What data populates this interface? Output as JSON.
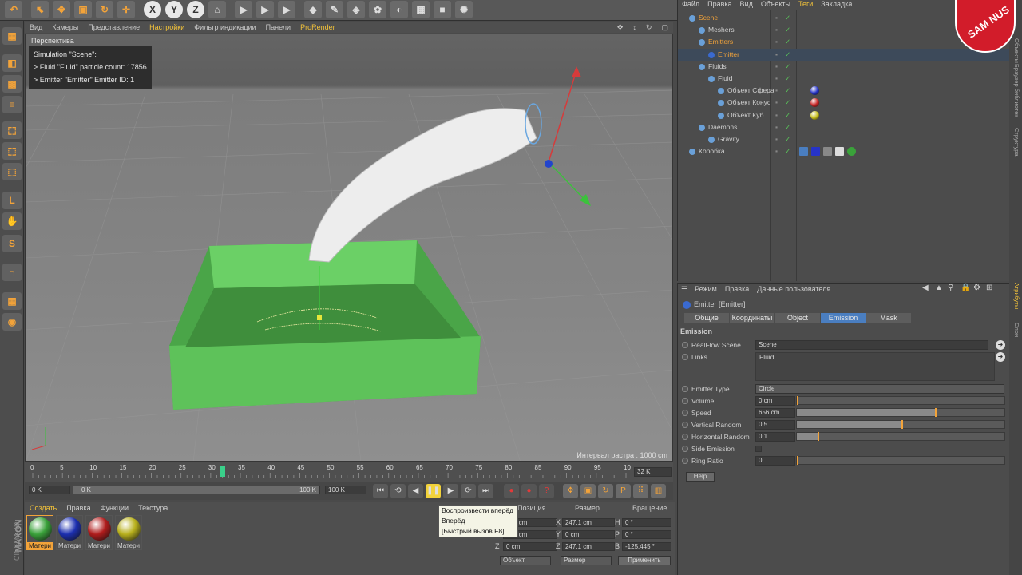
{
  "colors": {
    "accent": "#f2a33a",
    "selected_tab": "#4a7ec0",
    "green_box": "#5ec25a",
    "mat_green": "#3aa23a",
    "mat_blue": "#1c2fb0",
    "mat_red": "#b01c1c",
    "mat_yellow": "#b8b01c"
  },
  "topbar_icons": [
    "undo-icon",
    "select-icon",
    "move-icon",
    "scale-icon",
    "rotate-icon",
    "add-icon",
    "x-axis-icon",
    "y-axis-icon",
    "z-axis-icon",
    "coord-icon",
    "render-icon",
    "render-view-icon",
    "render-settings-icon",
    "cube-icon",
    "pen-icon",
    "subdivide-icon",
    "deform-icon",
    "scene-icon",
    "floor-icon",
    "camera-icon",
    "light-icon"
  ],
  "viewport_menu": [
    "Вид",
    "Камеры",
    "Представление",
    "Настройки",
    "Фильтр индикации",
    "Панели",
    "ProRender"
  ],
  "viewport": {
    "label": "Перспектива",
    "hud": [
      "Simulation \"Scene\":",
      "> Fluid \"Fluid\" particle count: 17856",
      "> Emitter \"Emitter\" Emitter ID: 1"
    ],
    "grid_info": "Интервал растра : 1000 cm"
  },
  "timeline": {
    "ticks": [
      "0",
      "5",
      "10",
      "15",
      "20",
      "25",
      "30",
      "35",
      "40",
      "45",
      "50",
      "55",
      "60",
      "65",
      "70",
      "75",
      "80",
      "85",
      "90",
      "95",
      "10"
    ],
    "end_frame": "32 K",
    "current": 0.32
  },
  "transport": {
    "start": "0 K",
    "range_start": "0 K",
    "range_end": "100 K",
    "end": "100 K"
  },
  "tooltip": [
    "Воспроизвести вперёд",
    "Вперёд",
    "[Быстрый вызов F8]"
  ],
  "materials": {
    "menu": [
      "Создать",
      "Правка",
      "Функции",
      "Текстура"
    ],
    "items": [
      "Матери",
      "Матери",
      "Матери",
      "Матери"
    ],
    "brand": "MAXON",
    "product": "CINEMA 4D"
  },
  "coords": {
    "headers": [
      "Позиция",
      "Размер",
      "Вращение"
    ],
    "rows": [
      {
        "axis": "X",
        "pos": "158 cm",
        "size_axis": "X",
        "size": "247.1 cm",
        "rot_axis": "H",
        "rot": "0 °"
      },
      {
        "axis": "Y",
        "pos": "133 cm",
        "size_axis": "Y",
        "size": "0 cm",
        "rot_axis": "P",
        "rot": "0 °"
      },
      {
        "axis": "Z",
        "pos": "0 cm",
        "size_axis": "Z",
        "size": "247.1 cm",
        "rot_axis": "B",
        "rot": "-125.445 °"
      }
    ],
    "mode": "Объект",
    "size_mode": "Размер",
    "apply": "Применить"
  },
  "objmgr": {
    "menu": [
      "Файл",
      "Правка",
      "Вид",
      "Объекты",
      "Теги",
      "Закладка"
    ],
    "tree": [
      {
        "label": "Scene",
        "indent": 0,
        "color": "#f2a33a"
      },
      {
        "label": "Meshers",
        "indent": 1,
        "color": "#cfcfcf"
      },
      {
        "label": "Emitters",
        "indent": 1,
        "color": "#f2a33a"
      },
      {
        "label": "Emitter",
        "indent": 2,
        "color": "#f2a33a"
      },
      {
        "label": "Fluids",
        "indent": 1,
        "color": "#cfcfcf"
      },
      {
        "label": "Fluid",
        "indent": 2,
        "color": "#cfcfcf"
      },
      {
        "label": "Объект Сфера",
        "indent": 3,
        "color": "#cfcfcf"
      },
      {
        "label": "Объект Конус",
        "indent": 3,
        "color": "#cfcfcf"
      },
      {
        "label": "Объект Куб",
        "indent": 3,
        "color": "#cfcfcf"
      },
      {
        "label": "Daemons",
        "indent": 1,
        "color": "#cfcfcf"
      },
      {
        "label": "Gravity",
        "indent": 2,
        "color": "#cfcfcf"
      },
      {
        "label": "Коробка",
        "indent": 0,
        "color": "#cfcfcf"
      }
    ]
  },
  "attr": {
    "menu": [
      "Режим",
      "Правка",
      "Данные пользователя"
    ],
    "title": "Emitter [Emitter]",
    "tabs": [
      "Общие",
      "Координаты",
      "Object",
      "Emission",
      "Mask"
    ],
    "active_tab": 3,
    "section": "Emission",
    "realflow_label": "RealFlow Scene",
    "realflow_value": "Scene",
    "links_label": "Links",
    "links_value": "Fluid",
    "params": [
      {
        "label": "Emitter Type",
        "value": "Circle",
        "kind": "dropdown"
      },
      {
        "label": "Volume",
        "value": "0 cm",
        "kind": "slider",
        "fill": 0.0
      },
      {
        "label": "Speed",
        "value": "656 cm",
        "kind": "slider",
        "fill": 0.66
      },
      {
        "label": "Vertical Random",
        "value": "0.5",
        "kind": "slider",
        "fill": 0.5
      },
      {
        "label": "Horizontal Random",
        "value": "0.1",
        "kind": "slider",
        "fill": 0.1
      },
      {
        "label": "Side Emission",
        "value": "",
        "kind": "checkbox"
      },
      {
        "label": "Ring Ratio",
        "value": "0",
        "kind": "slider",
        "fill": 0.0
      }
    ],
    "help": "Help"
  },
  "right_strip": [
    "Объекты",
    "Браузер библиотек",
    "Структура",
    "Атрибуты",
    "Слои"
  ],
  "logo": "SAM NUS"
}
